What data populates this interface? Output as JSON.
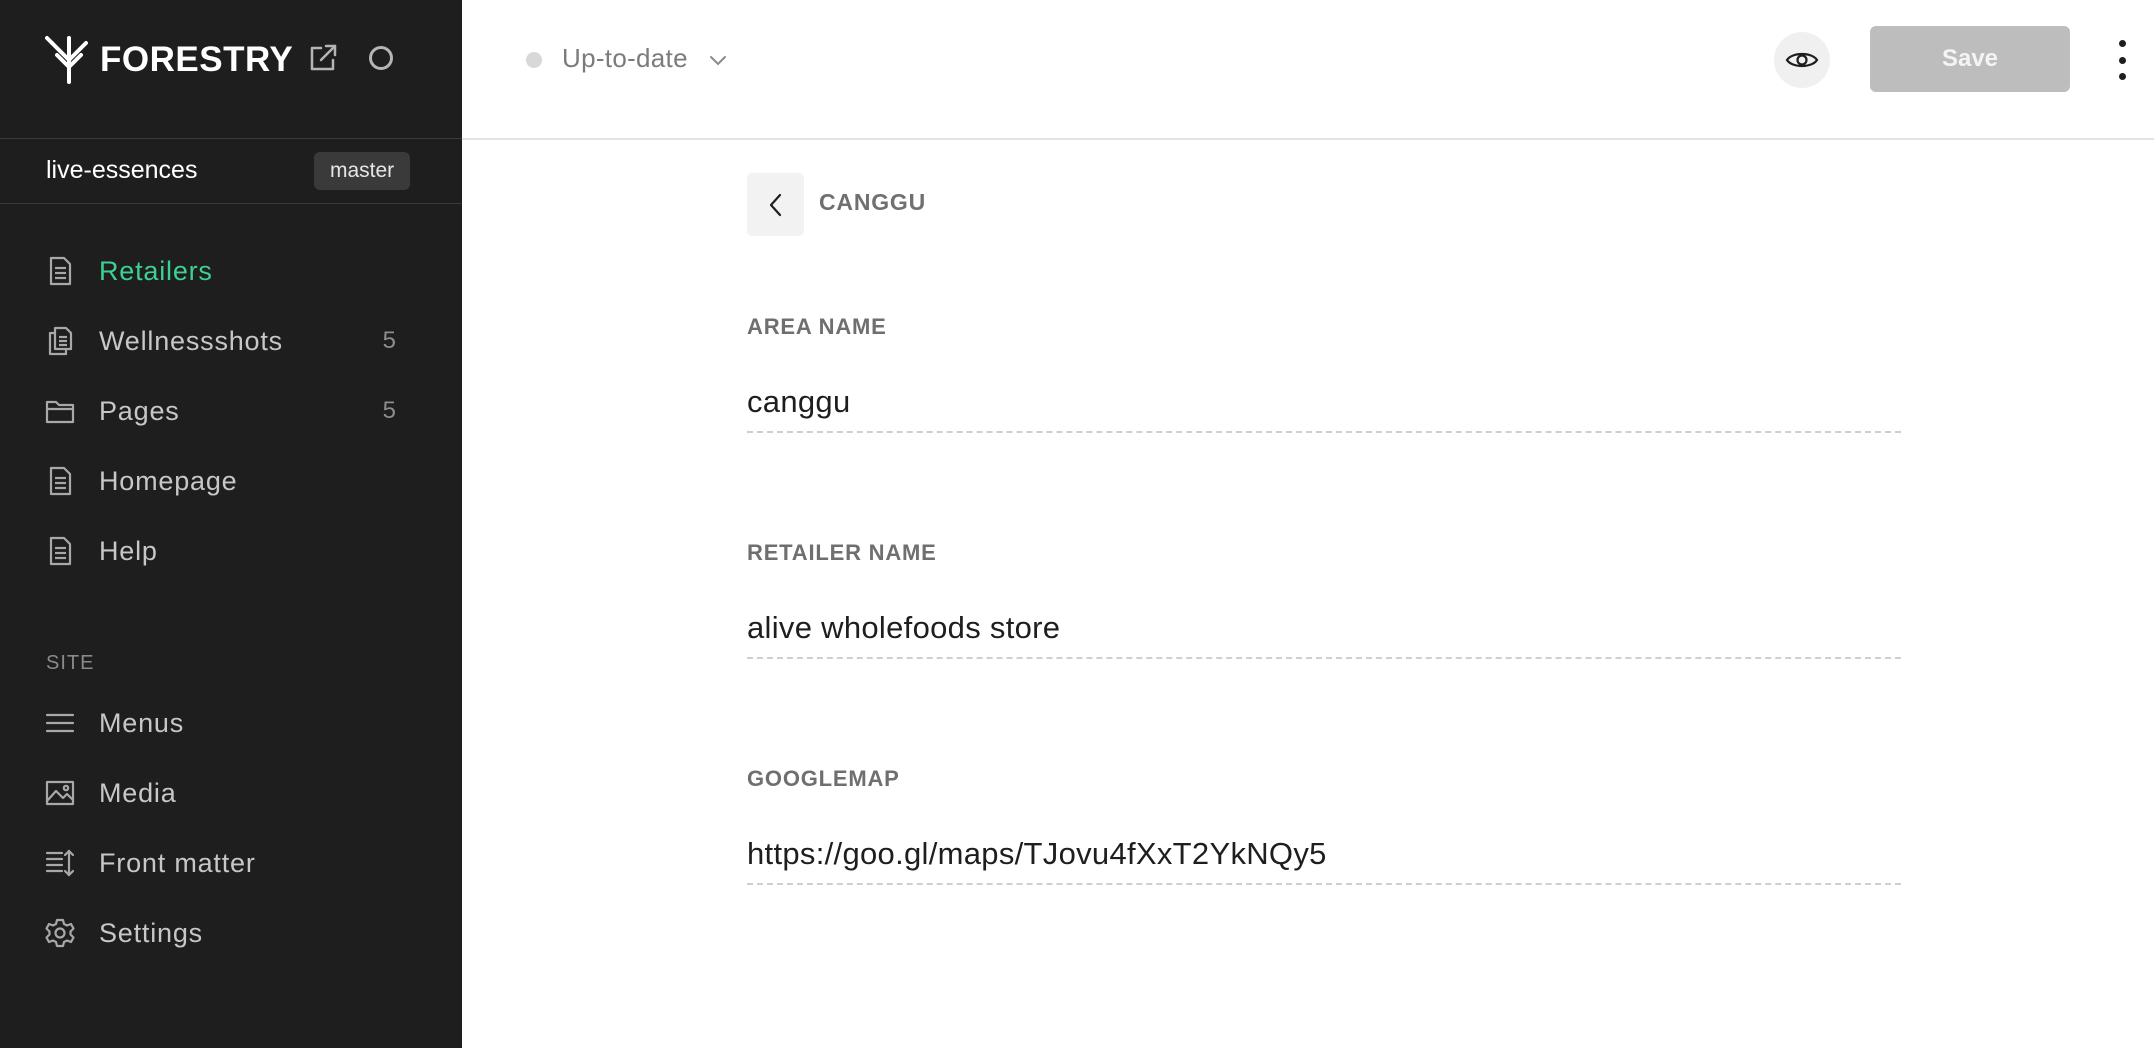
{
  "app": {
    "brand": "FORESTRY"
  },
  "sidebar": {
    "site_name": "live-essences",
    "branch": "master",
    "items": [
      {
        "label": "Retailers",
        "count": "",
        "icon": "document-icon",
        "active": true
      },
      {
        "label": "Wellnessshots",
        "count": "5",
        "icon": "documents-icon"
      },
      {
        "label": "Pages",
        "count": "5",
        "icon": "folder-icon"
      },
      {
        "label": "Homepage",
        "count": "",
        "icon": "document-icon"
      },
      {
        "label": "Help",
        "count": "",
        "icon": "document-icon"
      }
    ],
    "site_section": "SITE",
    "site_items": [
      {
        "label": "Menus",
        "icon": "menu-icon"
      },
      {
        "label": "Media",
        "icon": "image-icon"
      },
      {
        "label": "Front matter",
        "icon": "front-matter-icon"
      },
      {
        "label": "Settings",
        "icon": "gear-icon"
      }
    ]
  },
  "topbar": {
    "status": "Up-to-date",
    "save_label": "Save"
  },
  "editor": {
    "breadcrumb": "CANGGU",
    "fields": [
      {
        "label": "AREA NAME",
        "value": "canggu"
      },
      {
        "label": "RETAILER NAME",
        "value": "alive wholefoods store"
      },
      {
        "label": "GOOGLEMAP",
        "value": "https://goo.gl/maps/TJovu4fXxT2YkNQy5"
      }
    ]
  },
  "colors": {
    "sidebar_bg": "#1e1e1e",
    "active": "#3cd092",
    "save_disabled": "#bdbdbd"
  }
}
